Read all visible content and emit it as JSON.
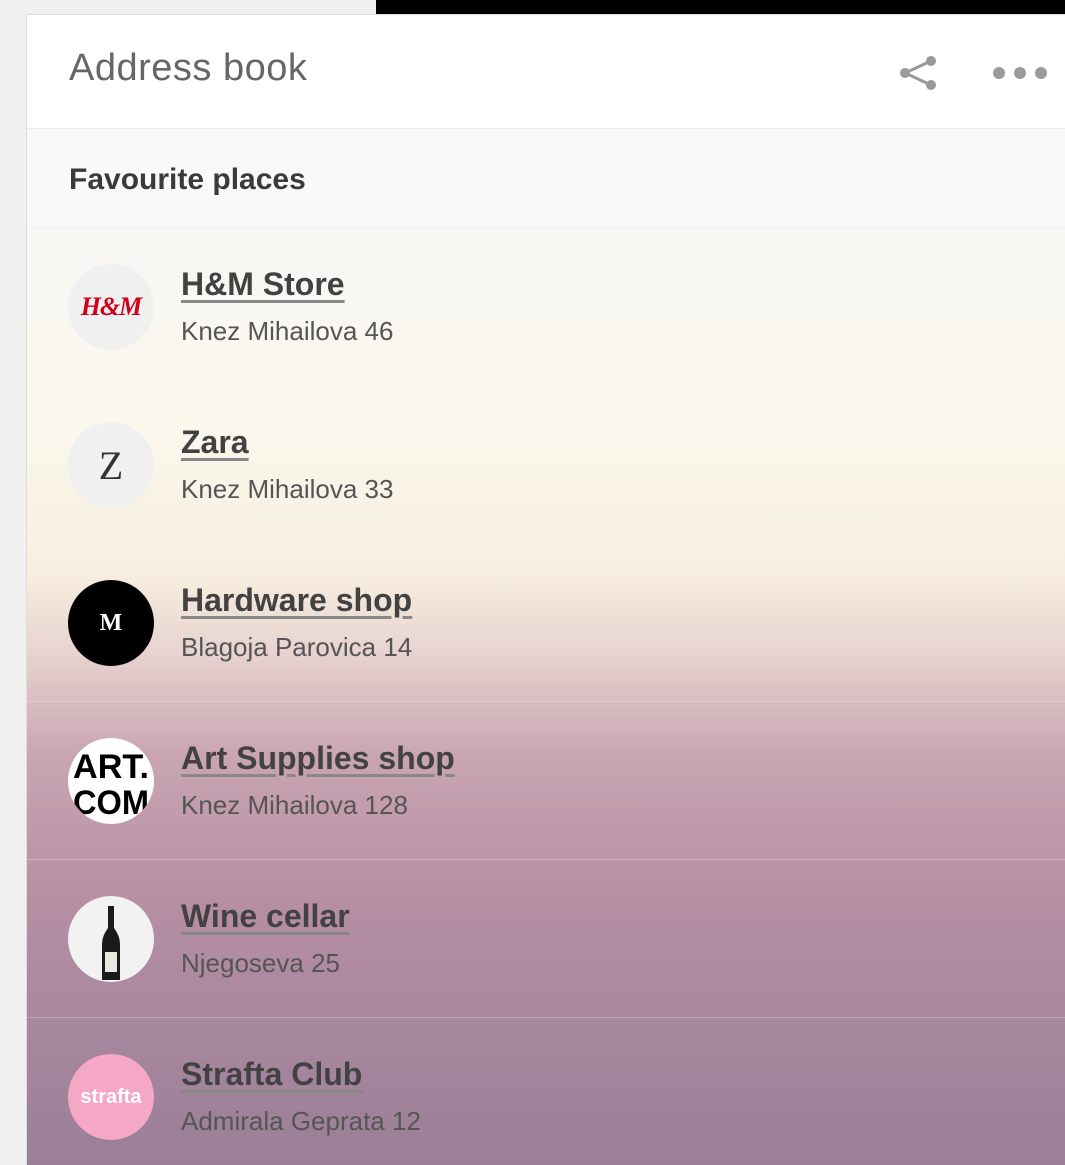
{
  "header": {
    "title": "Address book",
    "share_icon": "share-icon",
    "more_icon": "more-horizontal-icon"
  },
  "section": {
    "label": "Favourite places"
  },
  "places": [
    {
      "name": "H&M Store",
      "address": "Knez Mihailova 46",
      "logo": "H&M"
    },
    {
      "name": "Zara",
      "address": "Knez Mihailova 33",
      "logo": "Z"
    },
    {
      "name": "Hardware shop",
      "address": "Blagoja Parovica 14",
      "logo": "M"
    },
    {
      "name": "Art Supplies shop",
      "address": "Knez Mihailova 128",
      "logo": "ART.COM"
    },
    {
      "name": "Wine cellar",
      "address": "Njegoseva 25",
      "logo": ""
    },
    {
      "name": "Strafta Club",
      "address": "Admirala Geprata 12",
      "logo": "strafta"
    }
  ],
  "colors": {
    "accent": "#424242",
    "hm_red": "#d0021b",
    "strafta_pink": "#f4a7c6"
  }
}
